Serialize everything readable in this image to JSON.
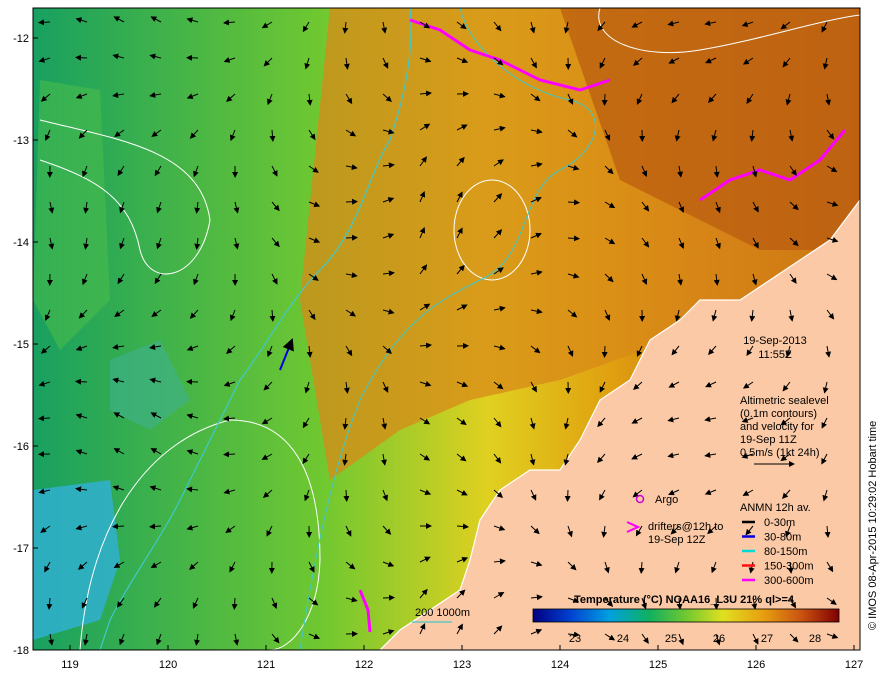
{
  "map": {
    "lon_ticks": [
      "119",
      "120",
      "121",
      "122",
      "123",
      "124",
      "125",
      "126",
      "127"
    ],
    "lat_ticks": [
      "-12",
      "-13",
      "-14",
      "-15",
      "-16",
      "-17",
      "-18"
    ],
    "date": "19-Sep-2013",
    "time": "11:55Z",
    "altimetry_notes": [
      "Altimetric sealevel",
      "(0.1m contours)",
      "and velocity for",
      "19-Sep 11Z",
      "0.5m/s (1kt 24h)"
    ],
    "argo_label": "Argo",
    "drifters_label": [
      "drifters@12h to",
      "19-Sep 12Z"
    ],
    "anmn_title": "ANMN 12h av.",
    "anmn_depths": [
      {
        "label": "0-30m",
        "color": "#000000"
      },
      {
        "label": "30-80m",
        "color": "#0000e0"
      },
      {
        "label": "80-150m",
        "color": "#00d8d8"
      },
      {
        "label": "150-300m",
        "color": "#ff1010"
      },
      {
        "label": "300-600m",
        "color": "#ff00ff"
      }
    ],
    "isobath_label": "200  1000m",
    "colorbar_title": "Temperature (°C) NOAA16_L3U 21% ql>=4",
    "colorbar_ticks": [
      "23",
      "24",
      "25",
      "26",
      "27",
      "28"
    ],
    "credit": "© IMOS 08-Apr-2015 10:29:02 Hobart time"
  },
  "colors": {
    "land": "#fbc9a5",
    "contour": "#ffffff",
    "isobath": "#40c8c8",
    "drifter": "#ff00ff"
  }
}
